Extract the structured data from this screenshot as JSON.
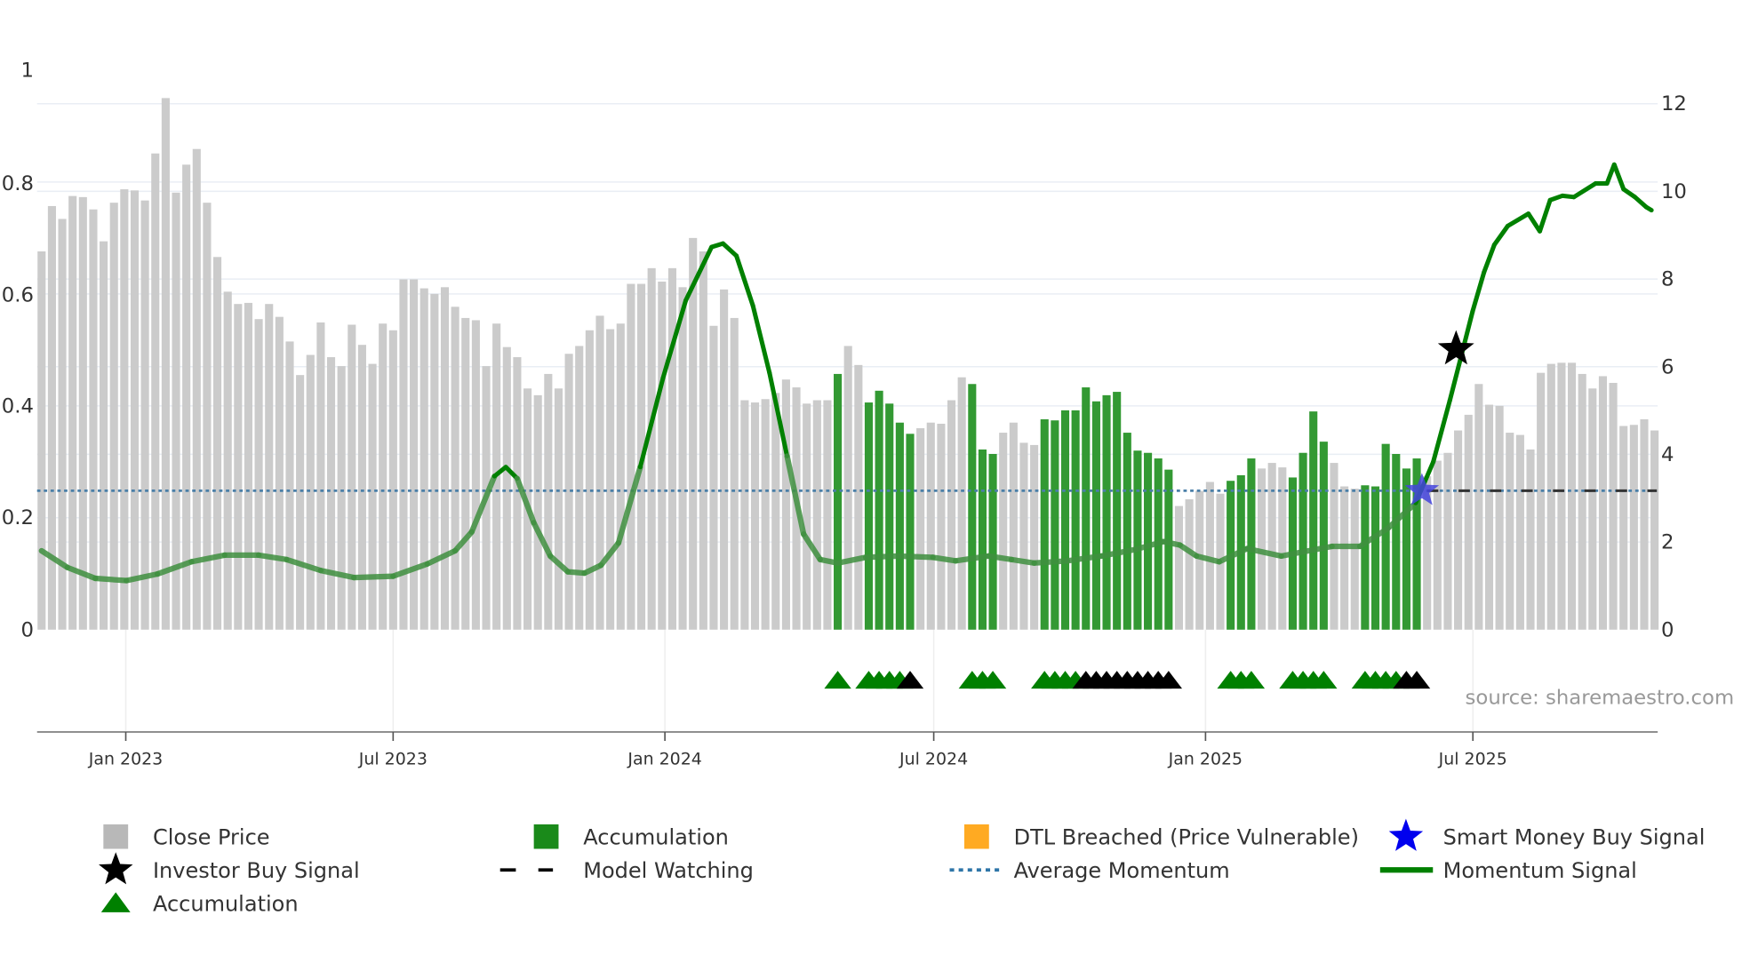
{
  "chart_data": {
    "type": "bar",
    "title": "",
    "x_start": "2022-11-05",
    "x_step_days": 7,
    "left_axis": {
      "label": "",
      "ylim": [
        0,
        1
      ],
      "ticks": [
        "0",
        "0.2",
        "0.4",
        "0.6",
        "0.8",
        "1"
      ]
    },
    "right_axis": {
      "label": "",
      "ylim": [
        0,
        12
      ],
      "ticks": [
        "0",
        "2",
        "4",
        "6",
        "8",
        "10",
        "12"
      ]
    },
    "x_ticks": [
      {
        "label": "Jan 2023",
        "date": "2023-01-01"
      },
      {
        "label": "Jul 2023",
        "date": "2023-07-01"
      },
      {
        "label": "Jan 2024",
        "date": "2024-01-01"
      },
      {
        "label": "Jul 2024",
        "date": "2024-07-01"
      },
      {
        "label": "Jan 2025",
        "date": "2025-01-01"
      },
      {
        "label": "Jul 2025",
        "date": "2025-07-01"
      }
    ],
    "close_price": [
      0.676,
      0.757,
      0.734,
      0.775,
      0.773,
      0.751,
      0.694,
      0.763,
      0.787,
      0.785,
      0.767,
      0.851,
      0.95,
      0.781,
      0.831,
      0.859,
      0.763,
      0.666,
      0.604,
      0.582,
      0.584,
      0.555,
      0.582,
      0.559,
      0.515,
      0.455,
      0.491,
      0.549,
      0.487,
      0.471,
      0.545,
      0.509,
      0.475,
      0.547,
      0.535,
      0.626,
      0.626,
      0.61,
      0.6,
      0.612,
      0.577,
      0.557,
      0.553,
      0.471,
      0.547,
      0.505,
      0.487,
      0.431,
      0.419,
      0.457,
      0.431,
      0.493,
      0.507,
      0.535,
      0.561,
      0.537,
      0.547,
      0.618,
      0.618,
      0.646,
      0.622,
      0.646,
      0.612,
      0.7,
      0.676,
      0.543,
      0.608,
      0.557,
      0.41,
      0.406,
      0.412,
      0.423,
      0.447,
      0.433,
      0.404,
      0.41,
      0.41,
      0.457,
      0.507,
      0.473,
      0.406,
      0.427,
      0.404,
      0.37,
      0.35,
      0.36,
      0.37,
      0.368,
      0.41,
      0.451,
      0.439,
      0.322,
      0.314,
      0.352,
      0.37,
      0.334,
      0.33,
      0.376,
      0.374,
      0.392,
      0.392,
      0.433,
      0.408,
      0.419,
      0.425,
      0.352,
      0.32,
      0.316,
      0.306,
      0.286,
      0.221,
      0.233,
      0.248,
      0.264,
      0.243,
      0.266,
      0.276,
      0.306,
      0.288,
      0.298,
      0.29,
      0.272,
      0.316,
      0.39,
      0.336,
      0.298,
      0.256,
      0.252,
      0.258,
      0.256,
      0.332,
      0.314,
      0.288,
      0.306,
      0.274,
      0.302,
      0.316,
      0.356,
      0.384,
      0.439,
      0.402,
      0.4,
      0.352,
      0.348,
      0.322,
      0.459,
      0.475,
      0.477,
      0.477,
      0.457,
      0.431,
      0.453,
      0.441,
      0.364,
      0.366,
      0.376,
      0.356
    ],
    "accumulation_weeks": [
      77,
      80,
      81,
      82,
      83,
      84,
      90,
      91,
      92,
      97,
      98,
      99,
      100,
      101,
      102,
      103,
      104,
      105,
      106,
      107,
      108,
      109,
      115,
      116,
      117,
      121,
      122,
      123,
      124,
      128,
      129,
      130,
      131,
      132,
      133
    ],
    "accumulation_marker_black_weeks": [
      84,
      101,
      102,
      103,
      104,
      105,
      106,
      107,
      108,
      109,
      132,
      133
    ],
    "momentum_signal": [
      [
        0,
        1.8
      ],
      [
        2.5,
        1.42
      ],
      [
        5.2,
        1.17
      ],
      [
        8.2,
        1.12
      ],
      [
        11.2,
        1.27
      ],
      [
        14.5,
        1.55
      ],
      [
        17.7,
        1.7
      ],
      [
        21,
        1.7
      ],
      [
        23.7,
        1.6
      ],
      [
        27,
        1.35
      ],
      [
        30.2,
        1.19
      ],
      [
        34,
        1.22
      ],
      [
        37.3,
        1.5
      ],
      [
        40,
        1.8
      ],
      [
        41.6,
        2.23
      ],
      [
        43.8,
        3.5
      ],
      [
        44.9,
        3.71
      ],
      [
        46,
        3.45
      ],
      [
        47.6,
        2.44
      ],
      [
        49.2,
        1.68
      ],
      [
        50.9,
        1.32
      ],
      [
        52.5,
        1.29
      ],
      [
        54.1,
        1.47
      ],
      [
        55.8,
        1.98
      ],
      [
        57.9,
        3.71
      ],
      [
        60.1,
        5.74
      ],
      [
        62.3,
        7.51
      ],
      [
        64.8,
        8.73
      ],
      [
        65.9,
        8.81
      ],
      [
        67.2,
        8.53
      ],
      [
        68.8,
        7.39
      ],
      [
        70.4,
        5.86
      ],
      [
        72.1,
        3.96
      ],
      [
        73.7,
        2.18
      ],
      [
        75.3,
        1.6
      ],
      [
        77,
        1.52
      ],
      [
        79.7,
        1.65
      ],
      [
        82.9,
        1.68
      ],
      [
        86.2,
        1.65
      ],
      [
        88.4,
        1.57
      ],
      [
        91.6,
        1.68
      ],
      [
        93.8,
        1.6
      ],
      [
        96,
        1.52
      ],
      [
        99.2,
        1.57
      ],
      [
        102.5,
        1.68
      ],
      [
        105.8,
        1.83
      ],
      [
        108.5,
        2.01
      ],
      [
        110.1,
        1.93
      ],
      [
        111.7,
        1.68
      ],
      [
        113.9,
        1.55
      ],
      [
        116.6,
        1.85
      ],
      [
        119.9,
        1.68
      ],
      [
        122.1,
        1.78
      ],
      [
        124.8,
        1.9
      ],
      [
        127.5,
        1.9
      ],
      [
        130.2,
        2.31
      ],
      [
        132.9,
        2.89
      ],
      [
        134.6,
        3.83
      ],
      [
        136.2,
        5.23
      ],
      [
        137.3,
        6.24
      ],
      [
        138.4,
        7.26
      ],
      [
        139.5,
        8.15
      ],
      [
        140.5,
        8.78
      ],
      [
        141.8,
        9.21
      ],
      [
        143.8,
        9.49
      ],
      [
        144.9,
        9.09
      ],
      [
        145.9,
        9.8
      ],
      [
        147.1,
        9.9
      ],
      [
        148.2,
        9.87
      ],
      [
        150.3,
        10.18
      ],
      [
        151.4,
        10.18
      ],
      [
        152.1,
        10.61
      ],
      [
        153,
        10.05
      ],
      [
        154.1,
        9.87
      ],
      [
        155.2,
        9.64
      ],
      [
        155.7,
        9.57
      ]
    ],
    "average_momentum": 3.17,
    "model_watching_from_week": 134,
    "smart_money_buy_signal": {
      "week": 133.5,
      "momentum": 3.17
    },
    "investor_buy_signal": {
      "week": 136.8,
      "momentum": 6.4
    },
    "grid": true,
    "legend_position": "bottom",
    "legend": [
      {
        "label": "Close Price",
        "symbol": "square",
        "color": "#b8b8b8"
      },
      {
        "label": "Accumulation",
        "symbol": "square",
        "color": "#1a8a1a"
      },
      {
        "label": "DTL Breached (Price Vulnerable)",
        "symbol": "square",
        "color": "#ffaa22"
      },
      {
        "label": "Smart Money Buy Signal",
        "symbol": "star",
        "color": "#0000ee"
      },
      {
        "label": "Investor Buy Signal",
        "symbol": "star",
        "color": "#000000"
      },
      {
        "label": "Model Watching",
        "symbol": "dash",
        "color": "#000000"
      },
      {
        "label": "Average Momentum",
        "symbol": "dot",
        "color": "#2e75a8"
      },
      {
        "label": "Momentum Signal",
        "symbol": "line",
        "color": "#008000"
      },
      {
        "label": "Accumulation",
        "symbol": "triangle",
        "color": "#008000"
      }
    ],
    "colors": {
      "bar": "#cbcbcb",
      "accumulation_bar": "#339933",
      "momentum": "#008000",
      "momentum_faded": "#3f8f3f",
      "average": "#4a7fa8"
    }
  },
  "source": "source: sharemaestro.com"
}
